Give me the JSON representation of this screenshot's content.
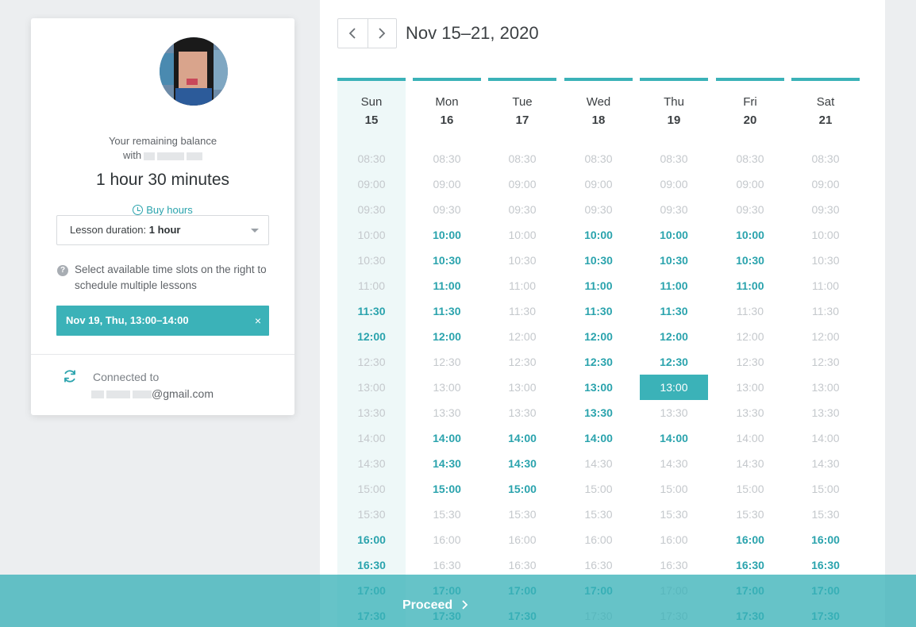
{
  "profile": {
    "balance_label": "Your remaining balance",
    "balance_with": "with",
    "balance_value": "1 hour 30 minutes",
    "buy_hours_label": "Buy hours"
  },
  "duration": {
    "label": "Lesson duration:",
    "value": "1 hour"
  },
  "hint": {
    "icon": "?",
    "text": "Select available time slots on the right to schedule multiple lessons"
  },
  "selected_lesson": {
    "label": "Nov 19, Thu, 13:00–14:00",
    "remove_label": "×"
  },
  "connection": {
    "label": "Connected to",
    "email_suffix": "@gmail.com"
  },
  "calendar": {
    "week_title": "Nov 15–21, 2020",
    "prev_label": "‹",
    "next_label": "›",
    "times": [
      "08:30",
      "09:00",
      "09:30",
      "10:00",
      "10:30",
      "11:00",
      "11:30",
      "12:00",
      "12:30",
      "13:00",
      "13:30",
      "14:00",
      "14:30",
      "15:00",
      "15:30",
      "16:00",
      "16:30",
      "17:00",
      "17:30"
    ],
    "days": [
      {
        "name": "Sun",
        "num": "15",
        "today": true,
        "available": [
          "11:30",
          "12:00",
          "16:00",
          "16:30",
          "17:00",
          "17:30"
        ]
      },
      {
        "name": "Mon",
        "num": "16",
        "today": false,
        "available": [
          "10:00",
          "10:30",
          "11:00",
          "11:30",
          "12:00",
          "14:00",
          "14:30",
          "15:00",
          "17:00",
          "17:30"
        ]
      },
      {
        "name": "Tue",
        "num": "17",
        "today": false,
        "available": [
          "14:00",
          "14:30",
          "15:00",
          "17:00",
          "17:30"
        ]
      },
      {
        "name": "Wed",
        "num": "18",
        "today": false,
        "available": [
          "10:00",
          "10:30",
          "11:00",
          "11:30",
          "12:00",
          "12:30",
          "13:00",
          "13:30",
          "14:00",
          "17:00"
        ]
      },
      {
        "name": "Thu",
        "num": "19",
        "today": false,
        "available": [
          "10:00",
          "10:30",
          "11:00",
          "11:30",
          "12:00",
          "12:30",
          "14:00"
        ],
        "selected": [
          "13:00"
        ]
      },
      {
        "name": "Fri",
        "num": "20",
        "today": false,
        "available": [
          "10:00",
          "10:30",
          "11:00",
          "16:00",
          "16:30",
          "17:00",
          "17:30"
        ]
      },
      {
        "name": "Sat",
        "num": "21",
        "today": false,
        "available": [
          "16:00",
          "16:30",
          "17:00",
          "17:30"
        ]
      }
    ]
  },
  "footer": {
    "proceed_label": "Proceed",
    "proceed_icon": "›"
  },
  "colors": {
    "accent": "#3bb2b8",
    "accent_text": "#2aa3ad",
    "unavailable_text": "#c4c8cc",
    "today_bg": "#eef8f8"
  }
}
